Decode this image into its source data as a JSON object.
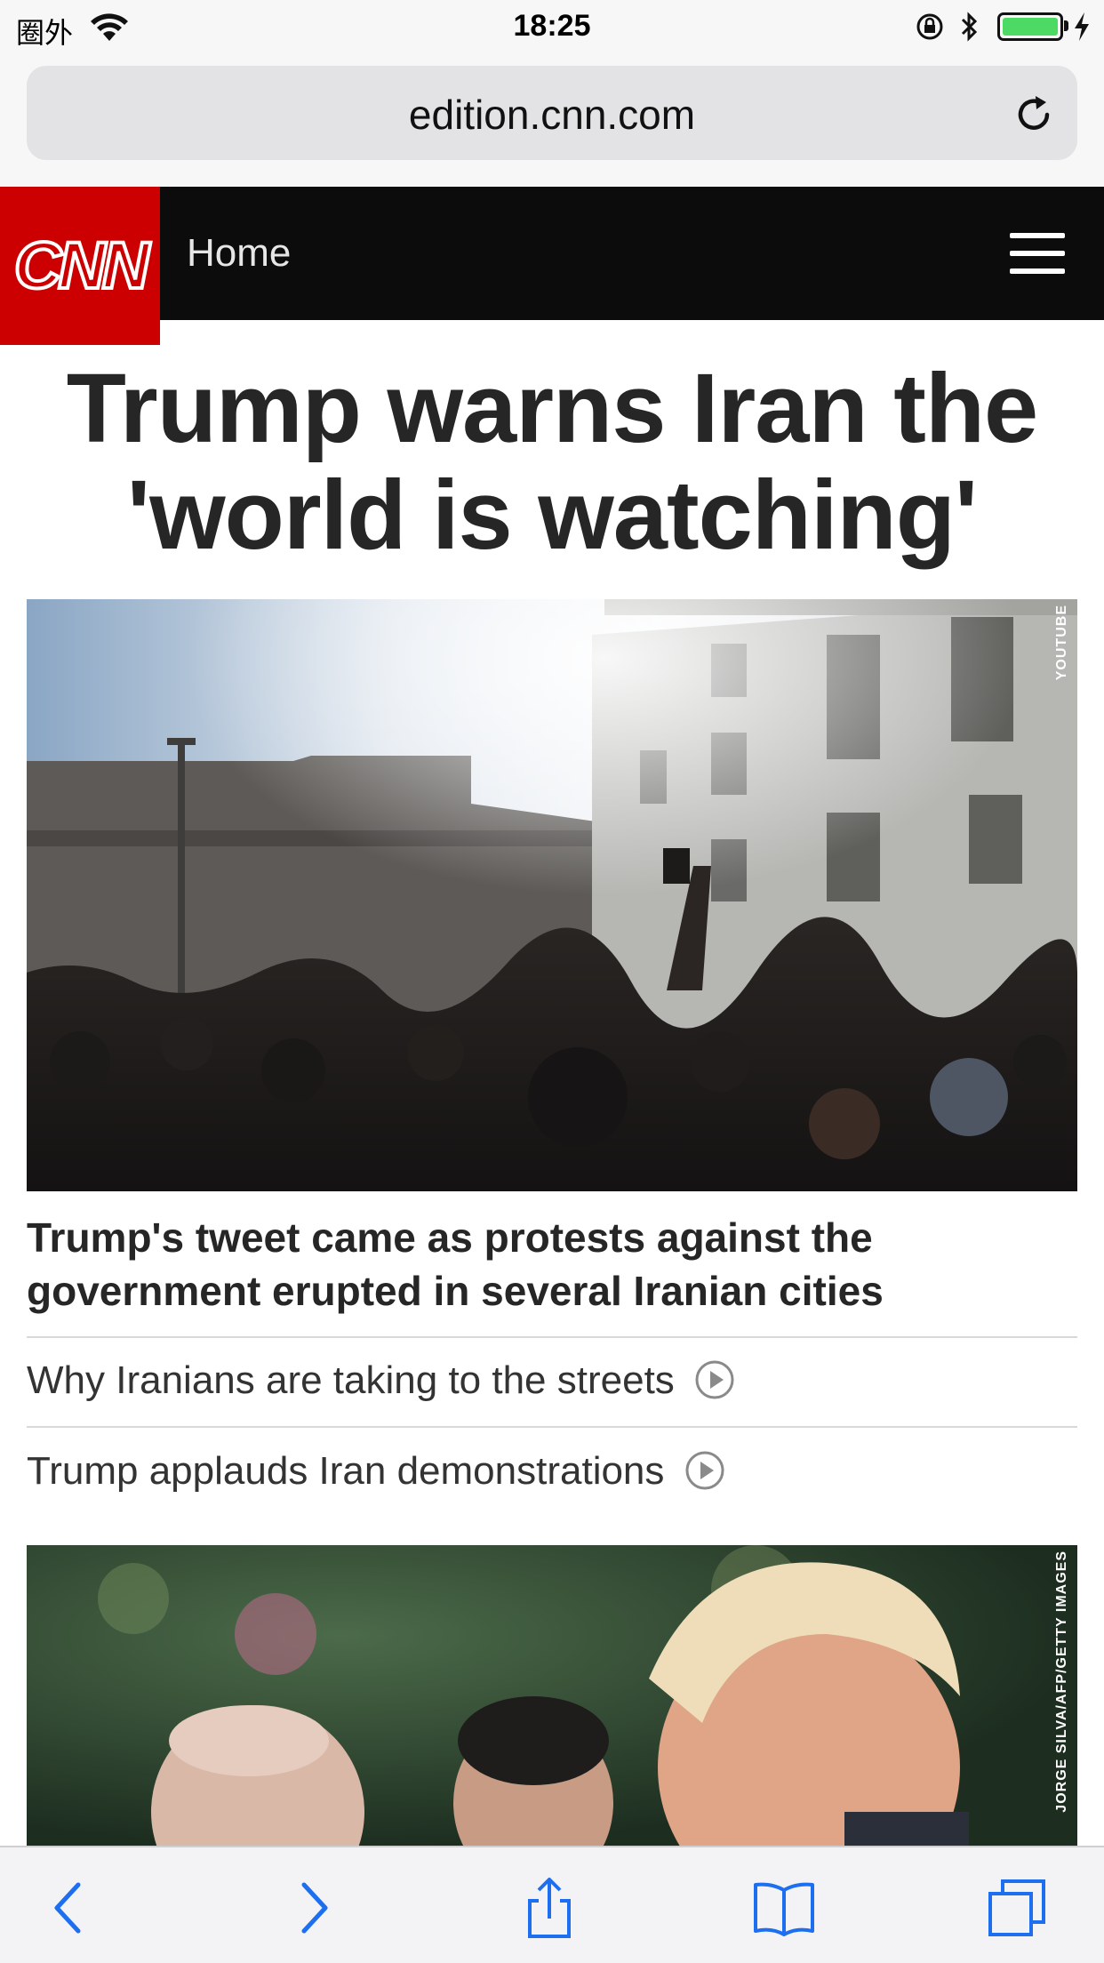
{
  "status_bar": {
    "carrier": "圈外",
    "time": "18:25",
    "battery_level": 1.0,
    "battery_color": "#4cd964"
  },
  "browser": {
    "url": "edition.cnn.com",
    "icons": [
      "reload-icon",
      "back-icon",
      "forward-icon",
      "share-icon",
      "bookmarks-icon",
      "tabs-icon"
    ],
    "accent_color": "#1e6ff0"
  },
  "site_header": {
    "logo": "CNN",
    "section": "Home",
    "brand_color": "#cc0000",
    "menu_icon": "hamburger-icon"
  },
  "article": {
    "headline": "Trump warns Iran the 'world is watching'",
    "image_credit": "YOUTUBE",
    "subheadline": "Trump's tweet came as protests against the government erupted in several Iranian cities",
    "related": [
      {
        "title": "Why Iranians are taking to the streets",
        "icon": "play-icon"
      },
      {
        "title": "Trump applauds Iran demonstrations",
        "icon": "play-icon"
      }
    ]
  },
  "next_story": {
    "image_credit": "JORGE SILVA/AFP/GETTY IMAGES"
  }
}
